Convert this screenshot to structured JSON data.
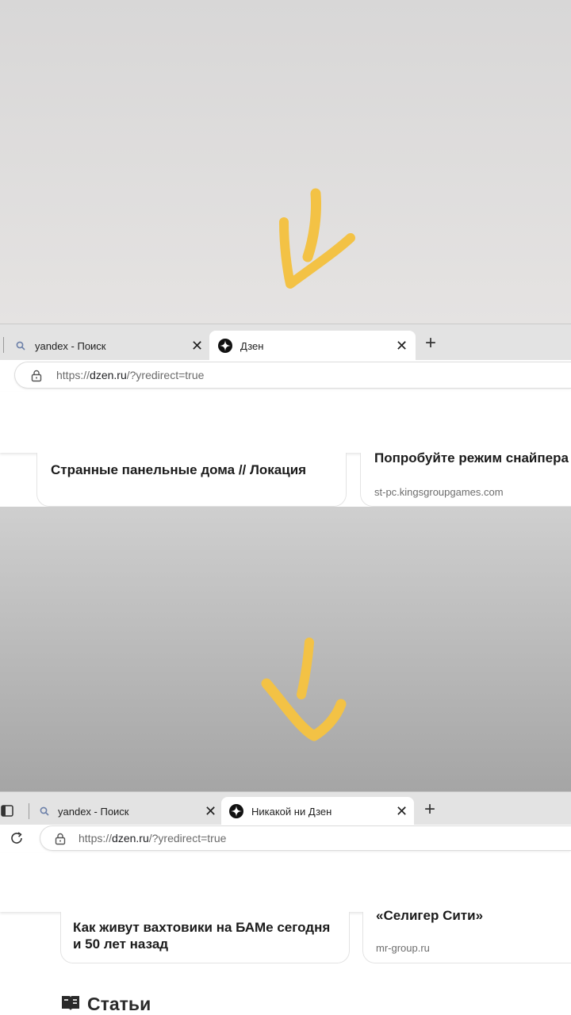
{
  "colors": {
    "arrow": "#f3c245",
    "tab_strip": "#e3e3e3",
    "active_tab": "#ffffff"
  },
  "frame1": {
    "tabs": [
      {
        "label": "yandex - Поиск",
        "icon": "search-icon",
        "close": "✕"
      },
      {
        "label": "Дзен",
        "icon": "dzen-logo-icon",
        "close": "✕"
      }
    ],
    "new_tab": "+",
    "address": {
      "prefix": "https://",
      "host": "dzen.ru",
      "path": "/?yredirect=true"
    },
    "cards": [
      {
        "title": "Странные панельные дома // Локация"
      },
      {
        "title": "Попробуйте режим снайпера",
        "source": "st-pc.kingsgroupgames.com"
      }
    ]
  },
  "frame2": {
    "tabs": [
      {
        "label": "yandex - Поиск",
        "icon": "search-icon",
        "close": "✕"
      },
      {
        "label": "Никакой ни Дзен",
        "icon": "dzen-logo-icon",
        "close": "✕"
      }
    ],
    "new_tab": "+",
    "address": {
      "prefix": "https://",
      "host": "dzen.ru",
      "path": "/?yredirect=true"
    },
    "cards": [
      {
        "title": "Как живут вахтовики на БАМе сегодня и 50 лет назад"
      },
      {
        "title": "«Селигер Сити»",
        "source": "mr-group.ru"
      }
    ],
    "section_heading": "Статьи"
  }
}
